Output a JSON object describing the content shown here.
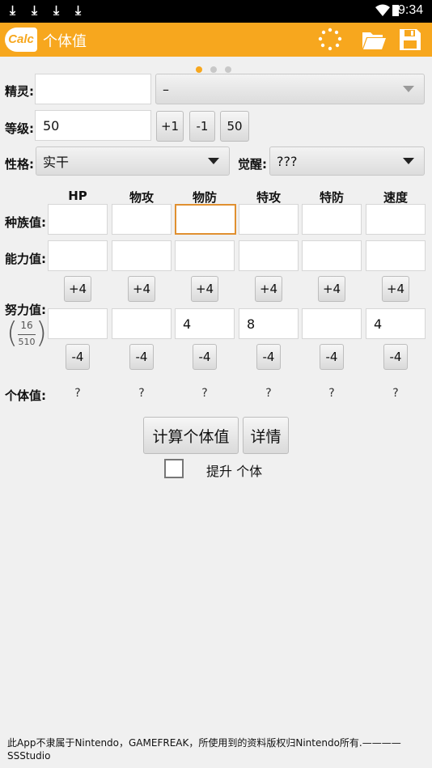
{
  "status_bar": {
    "time": "9:34"
  },
  "app_bar": {
    "logo": "Calc",
    "title": "个体值"
  },
  "form": {
    "pokemon_label": "精灵:",
    "pokemon_value": "",
    "pokemon_select": "–",
    "level_label": "等级:",
    "level_value": "50",
    "level_buttons": [
      "+1",
      "-1",
      "50"
    ],
    "nature_label": "性格:",
    "nature_value": "实干",
    "hidden_power_label": "觉醒:",
    "hidden_power_value": "???"
  },
  "stats": {
    "headers": [
      "HP",
      "物攻",
      "物防",
      "特攻",
      "特防",
      "速度"
    ],
    "base_label": "种族值:",
    "stat_label": "能力值:",
    "ev_label": "努力值:",
    "ev_fraction": {
      "numerator": "16",
      "denominator": "510"
    },
    "plus_label": "+4",
    "minus_label": "-4",
    "base_values": [
      "",
      "",
      "",
      "",
      "",
      ""
    ],
    "stat_values": [
      "",
      "",
      "",
      "",
      "",
      ""
    ],
    "ev_values": [
      "",
      "",
      "4",
      "8",
      "",
      "4"
    ],
    "iv_label": "个体值:",
    "iv_values": [
      "?",
      "?",
      "?",
      "?",
      "?",
      "?"
    ]
  },
  "actions": {
    "calculate": "计算个体值",
    "details": "详情",
    "checkbox_label": "提升 个体",
    "checkbox_checked": false
  },
  "footer": {
    "line1": "此App不隶属于Nintendo，GAMEFREAK，所使用到的资料版权归Nintendo所有.————",
    "line2": "SSStudio"
  },
  "colors": {
    "accent": "#f7a71e",
    "focus": "#e09030"
  }
}
